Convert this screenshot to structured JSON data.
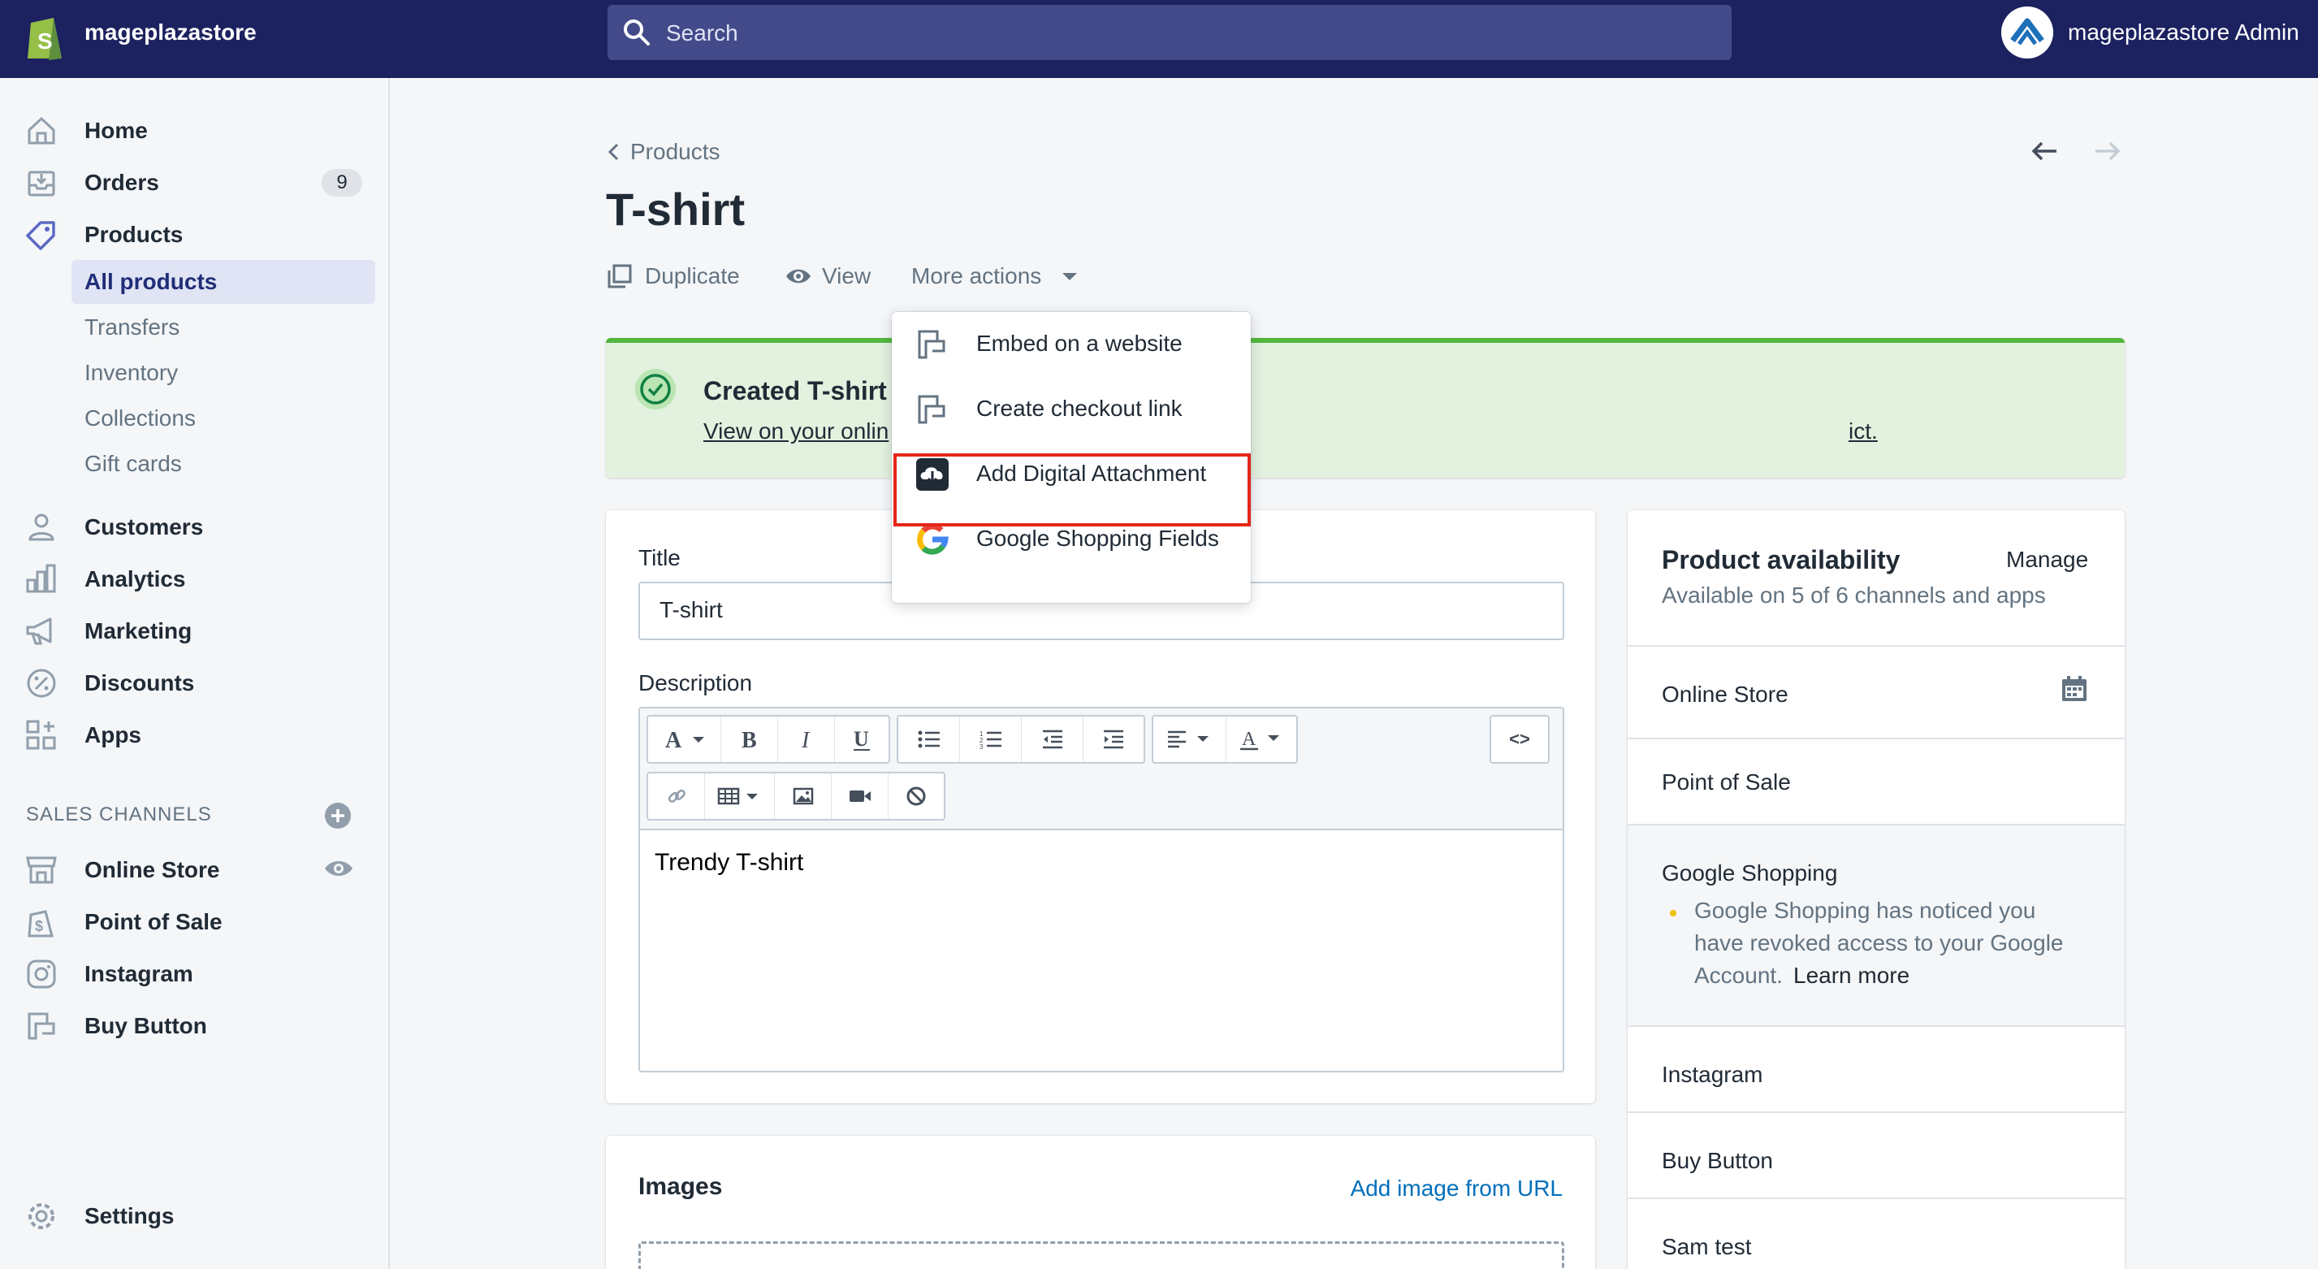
{
  "topbar": {
    "store_name": "mageplazastore",
    "search_placeholder": "Search",
    "admin_name": "mageplazastore Admin"
  },
  "sidebar": {
    "items": [
      {
        "label": "Home",
        "icon": "home-icon"
      },
      {
        "label": "Orders",
        "icon": "orders-icon",
        "badge": "9"
      },
      {
        "label": "Products",
        "icon": "tag-icon"
      }
    ],
    "product_sub": [
      {
        "label": "All products",
        "active": true
      },
      {
        "label": "Transfers"
      },
      {
        "label": "Inventory"
      },
      {
        "label": "Collections"
      },
      {
        "label": "Gift cards"
      }
    ],
    "items2": [
      {
        "label": "Customers",
        "icon": "person-icon"
      },
      {
        "label": "Analytics",
        "icon": "bar-chart-icon"
      },
      {
        "label": "Marketing",
        "icon": "megaphone-icon"
      },
      {
        "label": "Discounts",
        "icon": "discount-icon"
      },
      {
        "label": "Apps",
        "icon": "apps-icon"
      }
    ],
    "sales_channels_heading": "SALES CHANNELS",
    "channels": [
      {
        "label": "Online Store",
        "icon": "store-icon"
      },
      {
        "label": "Point of Sale",
        "icon": "shopping-bag-icon"
      },
      {
        "label": "Instagram",
        "icon": "instagram-icon"
      },
      {
        "label": "Buy Button",
        "icon": "buy-button-icon"
      }
    ],
    "settings": "Settings"
  },
  "main": {
    "breadcrumb": "Products",
    "title": "T-shirt",
    "actions": {
      "duplicate": "Duplicate",
      "view": "View",
      "more": "More actions"
    },
    "banner": {
      "title": "Created T-shirt",
      "link_start": "View on your onlin",
      "link_end": "ict."
    },
    "form": {
      "title_label": "Title",
      "title_value": "T-shirt",
      "description_label": "Description",
      "description_value": "Trendy T-shirt",
      "html_toggle": "<>"
    },
    "images": {
      "heading": "Images",
      "add_from_url": "Add image from URL"
    }
  },
  "dropdown": {
    "items": [
      {
        "label": "Embed on a website",
        "icon": "buy-button-icon"
      },
      {
        "label": "Create checkout link",
        "icon": "buy-button-icon"
      },
      {
        "label": "Add Digital Attachment",
        "icon": "cloud-download-icon",
        "highlighted": true
      },
      {
        "label": "Google Shopping Fields",
        "icon": "google-icon"
      }
    ]
  },
  "availability": {
    "heading": "Product availability",
    "manage": "Manage",
    "summary": "Available on 5 of 6 channels and apps",
    "channels": {
      "online_store": "Online Store",
      "pos": "Point of Sale",
      "google": "Google Shopping",
      "google_warning_1": "Google Shopping has noticed you",
      "google_warning_2": "have revoked access to your Google",
      "google_warning_3": "Account.",
      "learn_more": "Learn more",
      "instagram": "Instagram",
      "buy_button": "Buy Button",
      "sam_test": "Sam test"
    }
  },
  "colors": {
    "topbar": "#1c2260",
    "accent_blue": "#006fbb",
    "success_green": "#50b83c",
    "highlight_red": "#e32619"
  }
}
